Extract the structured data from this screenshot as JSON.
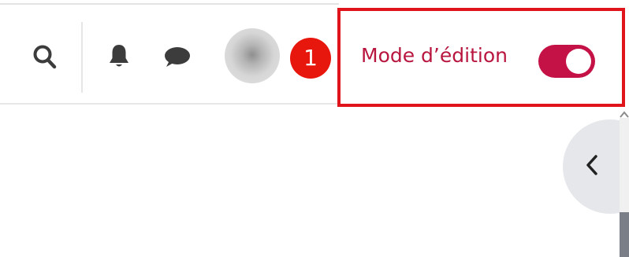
{
  "toolbar": {
    "icons": [
      "search-icon",
      "bell-icon",
      "chat-icon"
    ],
    "avatar": "avatar"
  },
  "annotation": {
    "step_number": "1",
    "color": "#e0141b"
  },
  "edit_mode": {
    "label": "Mode d’édition",
    "enabled": true,
    "toggle_color": "#c41146",
    "label_color": "#b8163f"
  },
  "drawer": {
    "toggle_icon": "chevron-left-icon"
  }
}
